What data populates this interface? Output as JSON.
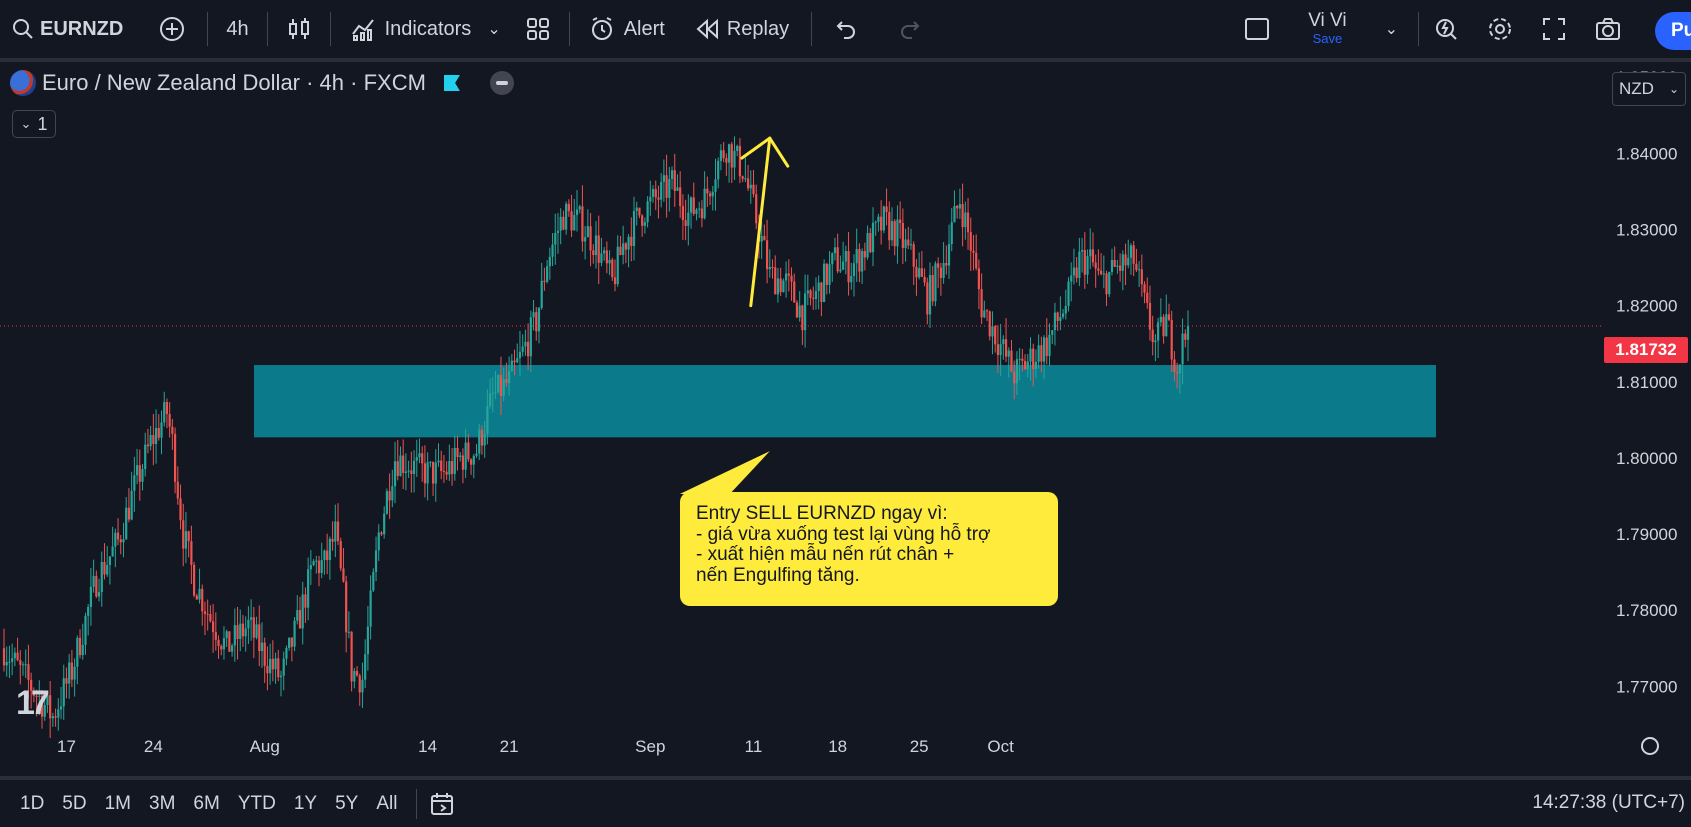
{
  "toolbar": {
    "symbol": "EURNZD",
    "interval": "4h",
    "indicators_label": "Indicators",
    "alert_label": "Alert",
    "replay_label": "Replay",
    "user_name": "Vi Vi",
    "save_label": "Save",
    "publish_label": "Pu",
    "icons": [
      "search-icon",
      "add-symbol-icon",
      "candles-icon",
      "indicators-icon",
      "templates-icon",
      "alert-icon",
      "replay-icon",
      "undo-icon",
      "redo-icon",
      "layout-icon",
      "quick-search-icon",
      "settings-icon",
      "fullscreen-icon",
      "camera-icon"
    ]
  },
  "legend": {
    "title": "Euro / New Zealand Dollar · 4h · FXCM",
    "collapse_count": "1"
  },
  "currency": "NZD",
  "last_price": "1.81732",
  "colors": {
    "background": "#131722",
    "up": "#26a69a",
    "down": "#ef5350",
    "zone": "#0b7b8b",
    "callout": "#ffeb3b",
    "arrow": "#ffeb3b",
    "price_badge": "#f23645"
  },
  "annotation": {
    "lines": [
      "Entry SELL EURNZD ngay vì:",
      "- giá vừa xuống test lại vùng hỗ trợ",
      "- xuất hiện mẫu nến rút chân +",
      "nến Engulfing tăng."
    ]
  },
  "chart_data": {
    "type": "candlestick",
    "ylim": [
      1.764,
      1.852
    ],
    "y_ticks": [
      "1.85000",
      "1.84000",
      "1.83000",
      "1.82000",
      "1.81000",
      "1.80000",
      "1.79000",
      "1.78000",
      "1.77000"
    ],
    "y_tick_values": [
      1.85,
      1.84,
      1.83,
      1.82,
      1.81,
      1.8,
      1.79,
      1.78,
      1.77
    ],
    "x_ticks": [
      "17",
      "24",
      "Aug",
      "14",
      "21",
      "Sep",
      "11",
      "18",
      "25",
      "Oct"
    ],
    "last_price_value": 1.81732,
    "zone": {
      "top": 1.8122,
      "bottom": 1.8027
    },
    "path": [
      [
        0,
        1.775
      ],
      [
        10,
        1.77
      ],
      [
        18,
        1.766
      ],
      [
        25,
        1.772
      ],
      [
        34,
        1.784
      ],
      [
        42,
        1.789
      ],
      [
        48,
        1.796
      ],
      [
        54,
        1.802
      ],
      [
        60,
        1.806
      ],
      [
        62,
        1.802
      ],
      [
        66,
        1.79
      ],
      [
        70,
        1.784
      ],
      [
        76,
        1.779
      ],
      [
        82,
        1.775
      ],
      [
        90,
        1.778
      ],
      [
        96,
        1.774
      ],
      [
        102,
        1.771
      ],
      [
        108,
        1.778
      ],
      [
        114,
        1.786
      ],
      [
        118,
        1.786
      ],
      [
        122,
        1.79
      ],
      [
        126,
        1.779
      ],
      [
        128,
        1.772
      ],
      [
        132,
        1.771
      ],
      [
        138,
        1.79
      ],
      [
        144,
        1.8
      ],
      [
        150,
        1.799
      ],
      [
        156,
        1.798
      ],
      [
        162,
        1.798
      ],
      [
        168,
        1.8
      ],
      [
        174,
        1.801
      ],
      [
        180,
        1.808
      ],
      [
        186,
        1.81
      ],
      [
        190,
        1.813
      ],
      [
        196,
        1.818
      ],
      [
        200,
        1.826
      ],
      [
        206,
        1.832
      ],
      [
        212,
        1.831
      ],
      [
        218,
        1.828
      ],
      [
        224,
        1.823
      ],
      [
        228,
        1.828
      ],
      [
        234,
        1.832
      ],
      [
        240,
        1.834
      ],
      [
        246,
        1.836
      ],
      [
        252,
        1.832
      ],
      [
        258,
        1.834
      ],
      [
        262,
        1.838
      ],
      [
        266,
        1.841
      ],
      [
        272,
        1.838
      ],
      [
        278,
        1.83
      ],
      [
        282,
        1.824
      ],
      [
        288,
        1.823
      ],
      [
        294,
        1.819
      ],
      [
        300,
        1.822
      ],
      [
        306,
        1.826
      ],
      [
        312,
        1.825
      ],
      [
        318,
        1.828
      ],
      [
        324,
        1.831
      ],
      [
        330,
        1.829
      ],
      [
        336,
        1.825
      ],
      [
        340,
        1.821
      ],
      [
        346,
        1.826
      ],
      [
        352,
        1.834
      ],
      [
        356,
        1.828
      ],
      [
        360,
        1.82
      ],
      [
        364,
        1.817
      ],
      [
        368,
        1.814
      ],
      [
        372,
        1.811
      ],
      [
        378,
        1.813
      ],
      [
        384,
        1.815
      ],
      [
        388,
        1.818
      ],
      [
        392,
        1.821
      ],
      [
        396,
        1.826
      ],
      [
        400,
        1.826
      ],
      [
        404,
        1.823
      ],
      [
        410,
        1.825
      ],
      [
        416,
        1.826
      ],
      [
        420,
        1.82
      ],
      [
        424,
        1.815
      ],
      [
        428,
        1.818
      ],
      [
        432,
        1.812
      ],
      [
        434,
        1.815
      ],
      [
        436,
        1.817
      ]
    ],
    "x_tick_steps": [
      23,
      55,
      96,
      156,
      186,
      238,
      276,
      307,
      337,
      367
    ],
    "step_count": 437,
    "arrow": {
      "from": [
        275,
        1.82
      ],
      "to": [
        282,
        1.842
      ]
    },
    "callout_tail": [
      [
        282,
        1.8022
      ]
    ]
  }
}
